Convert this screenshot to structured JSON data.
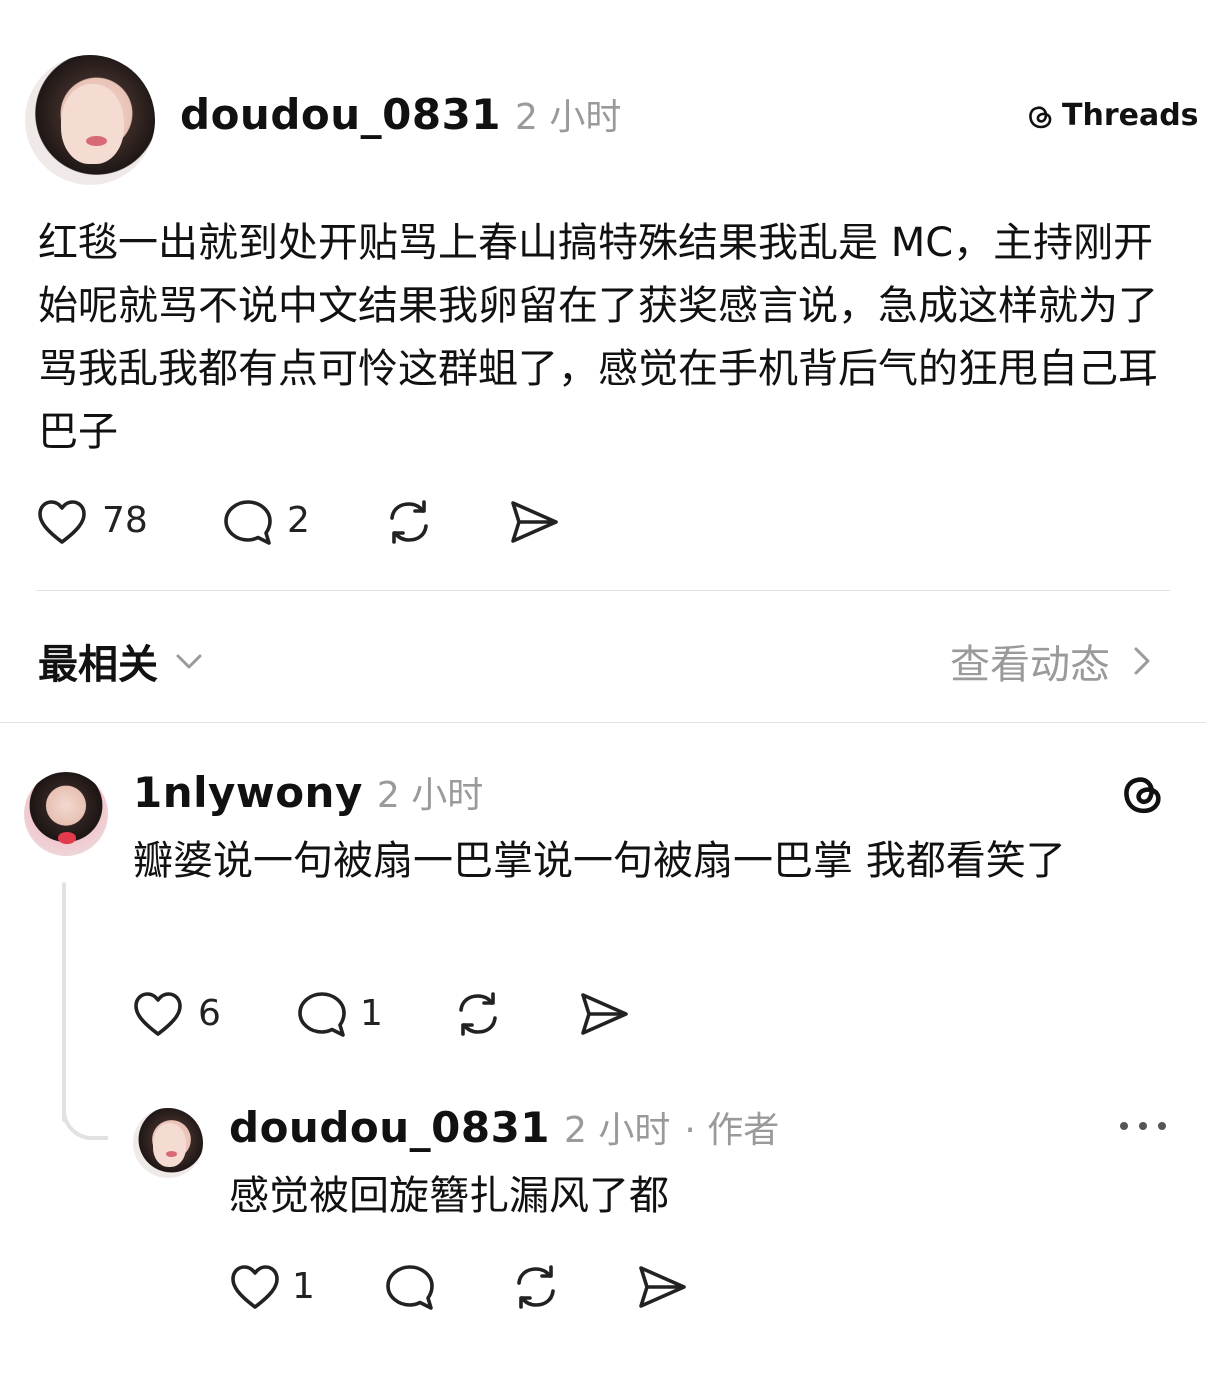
{
  "post": {
    "username": "doudou_0831",
    "time": "2 小时",
    "brand_label": "Threads",
    "text": "红毯一出就到处开贴骂上春山搞特殊结果我乱是 MC，主持刚开始呢就骂不说中文结果我卵留在了获奖感言说，急成这样就为了骂我乱我都有点可怜这群蛆了，感觉在手机背后气的狂甩自己耳巴子",
    "likes": "78",
    "replies": "2"
  },
  "sort_bar": {
    "sort_label": "最相关",
    "activity_label": "查看动态"
  },
  "comments": [
    {
      "username": "1nlywony",
      "time": "2 小时",
      "text": "瓣婆说一句被扇一巴掌说一句被扇一巴掌 我都看笑了",
      "likes": "6",
      "replies": "1"
    },
    {
      "username": "doudou_0831",
      "time": "2 小时",
      "author_tag": "· 作者",
      "text": "感觉被回旋簪扎漏风了都",
      "likes": "1"
    }
  ],
  "icons": {
    "like": "heart-icon",
    "reply": "speech-bubble-icon",
    "repost": "repost-icon",
    "share": "send-icon",
    "threads_logo": "threads-logo-icon",
    "more": "more-dots-icon",
    "chevron_down": "chevron-down-icon",
    "chevron_right": "chevron-right-icon"
  }
}
